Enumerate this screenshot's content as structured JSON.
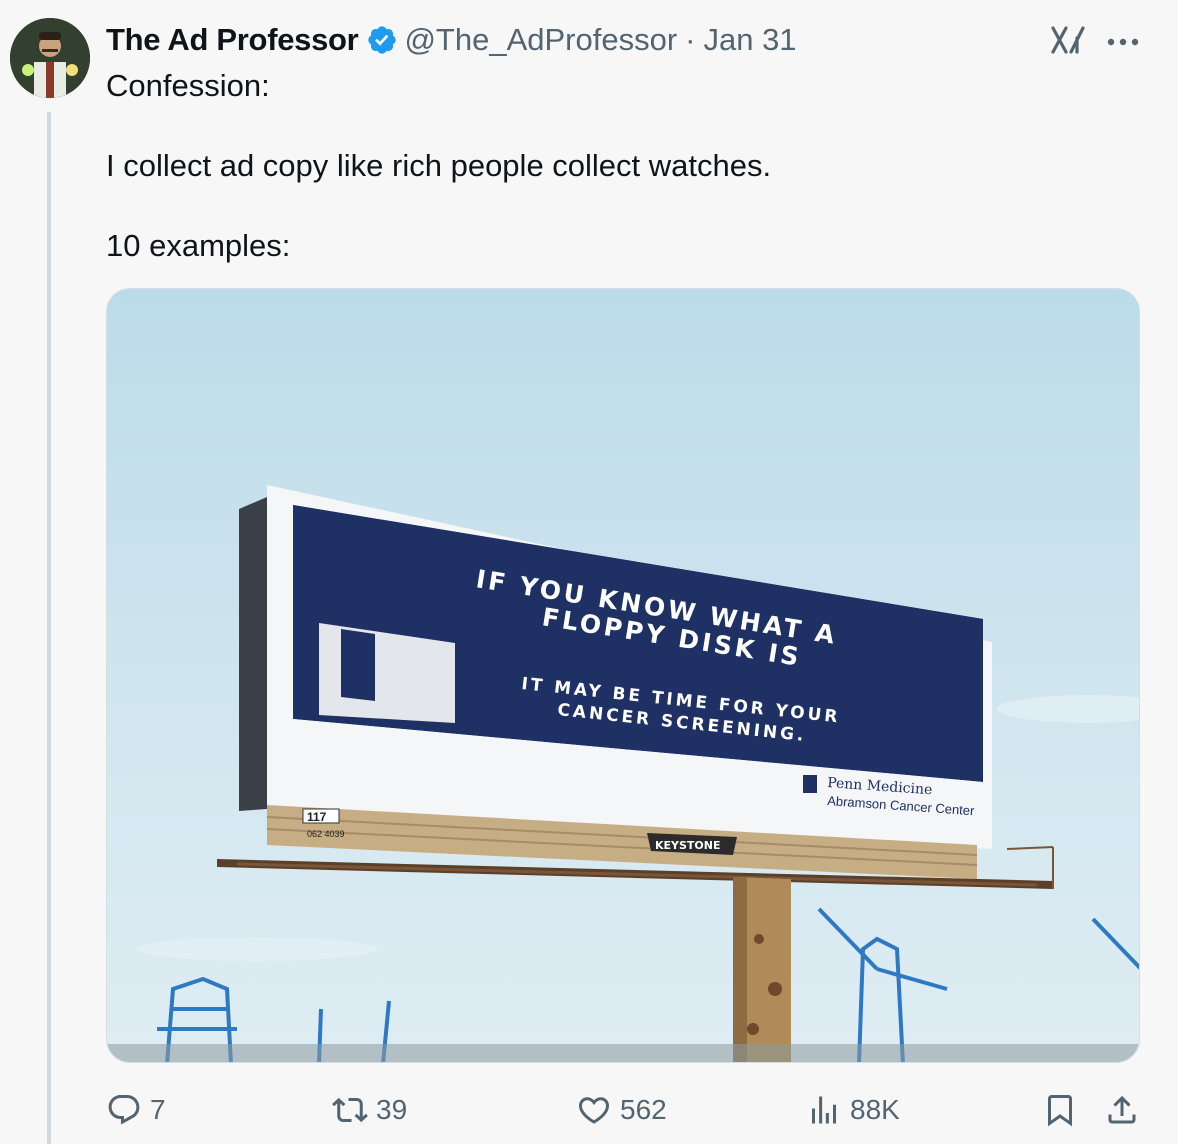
{
  "author": {
    "display_name": "The Ad Professor",
    "handle": "@The_AdProfessor",
    "separator": "·",
    "date": "Jan 31",
    "verified": true,
    "avatar_icon": "avatar-photo"
  },
  "tweet": {
    "lines": [
      "Confession:",
      "I collect ad copy like rich people collect watches.",
      "10 examples:"
    ]
  },
  "media": {
    "billboard": {
      "headline_line1": "IF YOU KNOW WHAT A",
      "headline_line2": "FLOPPY DISK IS",
      "sub_line1": "IT MAY BE TIME FOR YOUR",
      "sub_line2": "CANCER SCREENING.",
      "brand_line1": "Penn Medicine",
      "brand_line2": "Abramson Cancer Center",
      "panel_number": "117",
      "panel_code": "062 4039",
      "operator": "KEYSTONE"
    }
  },
  "actions": {
    "replies": "7",
    "reposts": "39",
    "likes": "562",
    "views": "88K"
  },
  "colors": {
    "verified": "#1d9bf0",
    "billboard_navy": "#1f3064",
    "muted_text": "#536471",
    "sky": "#cfe4ee"
  }
}
